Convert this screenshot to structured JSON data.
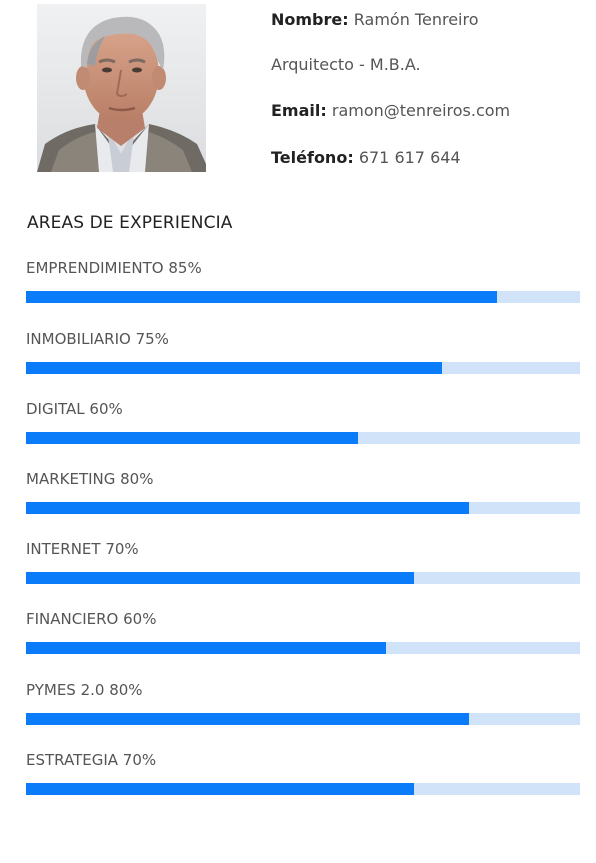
{
  "profile": {
    "name_label": "Nombre:",
    "name_value": "Ramón Tenreiro",
    "title": "Arquitecto - M.B.A.",
    "email_label": "Email:",
    "email_value": "ramon@tenreiros.com",
    "phone_label": "Teléfono:",
    "phone_value": "671 617 644",
    "photo_icon": "portrait-photo"
  },
  "section": {
    "title": "AREAS DE EXPERIENCIA"
  },
  "colors": {
    "bar_fill": "#0a7cf9",
    "bar_track": "#d0e3f8"
  },
  "skills": [
    {
      "label": "EMPRENDIMIENTO 85%",
      "percent": 85
    },
    {
      "label": "INMOBILIARIO 75%",
      "percent": 75
    },
    {
      "label": "DIGITAL 60%",
      "percent": 60
    },
    {
      "label": "MARKETING 80%",
      "percent": 80
    },
    {
      "label": "INTERNET 70%",
      "percent": 70
    },
    {
      "label": "FINANCIERO 60%",
      "percent": 65
    },
    {
      "label": "PYMES 2.0 80%",
      "percent": 80
    },
    {
      "label": "ESTRATEGIA 70%",
      "percent": 70
    }
  ]
}
